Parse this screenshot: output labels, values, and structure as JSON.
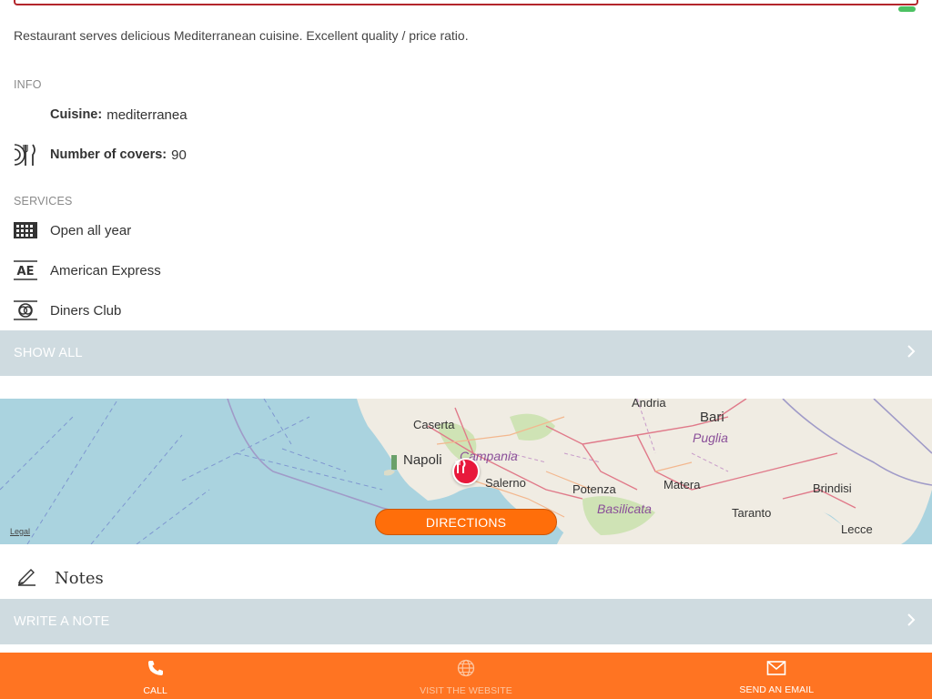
{
  "description": "Restaurant serves delicious Mediterranean cuisine. Excellent quality / price ratio.",
  "info": {
    "title": "INFO",
    "cuisine_label": "Cuisine:",
    "cuisine_value": "mediterranea",
    "covers_label": "Number of covers:",
    "covers_value": "90"
  },
  "services": {
    "title": "SERVICES",
    "items": [
      "Open all year",
      "American Express",
      "Diners Club"
    ],
    "show_all_label": "SHOW ALL"
  },
  "map": {
    "cities": [
      "Andria",
      "Bari",
      "Caserta",
      "Napoli",
      "Salerno",
      "Potenza",
      "Matera",
      "Brindisi",
      "Taranto",
      "Lecce"
    ],
    "regions": [
      "Campania",
      "Puglia",
      "Basilicata"
    ],
    "legal_label": "Legal",
    "directions_label": "DIRECTIONS"
  },
  "notes": {
    "title": "Notes",
    "write_label": "WRITE A NOTE"
  },
  "actions": {
    "call": "CALL",
    "website": "VISIT THE WEBSITE",
    "email": "SEND AN EMAIL"
  },
  "colors": {
    "accent": "#ff7422",
    "marker": "#e8193c",
    "bar": "#cfdbe0",
    "input_border": "#b3262c"
  },
  "icons": {
    "covers": "cutlery-icon",
    "open_all_year": "calendar-grid-icon",
    "amex": "amex-card-icon",
    "diners": "diners-card-icon",
    "notes": "pencil-icon",
    "chevron": "chevron-right-icon",
    "call": "phone-icon",
    "website": "globe-icon",
    "email": "envelope-icon",
    "marker": "restaurant-marker-icon"
  }
}
